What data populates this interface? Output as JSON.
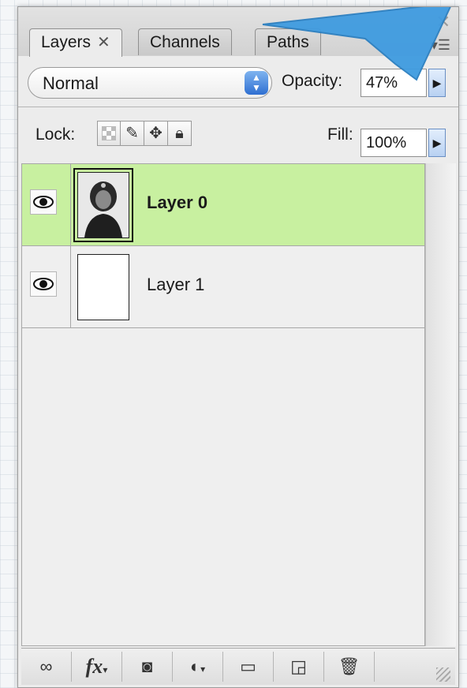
{
  "tabs": [
    {
      "label": "Layers"
    },
    {
      "label": "Channels"
    },
    {
      "label": "Paths"
    }
  ],
  "blend_mode": {
    "value": "Normal"
  },
  "opacity": {
    "label": "Opacity:",
    "value": "47%"
  },
  "lock": {
    "label": "Lock:"
  },
  "fill": {
    "label": "Fill:",
    "value": "100%"
  },
  "layers": [
    {
      "name": "Layer 0",
      "selected": true,
      "visible": true,
      "thumbnail": "portrait-photo"
    },
    {
      "name": "Layer 1",
      "selected": false,
      "visible": true,
      "thumbnail": "blank-white"
    }
  ],
  "bottom_buttons": [
    {
      "icon": "link-layers-icon"
    },
    {
      "icon": "layer-style-fx-icon",
      "label": "fx"
    },
    {
      "icon": "add-mask-icon"
    },
    {
      "icon": "adjustment-layer-icon"
    },
    {
      "icon": "new-group-folder-icon"
    },
    {
      "icon": "new-layer-icon"
    },
    {
      "icon": "delete-layer-trash-icon"
    }
  ],
  "colors": {
    "selected_row": "#c8f0a0",
    "callout": "#3f9be0",
    "accent_button": "#2f6fd1"
  }
}
